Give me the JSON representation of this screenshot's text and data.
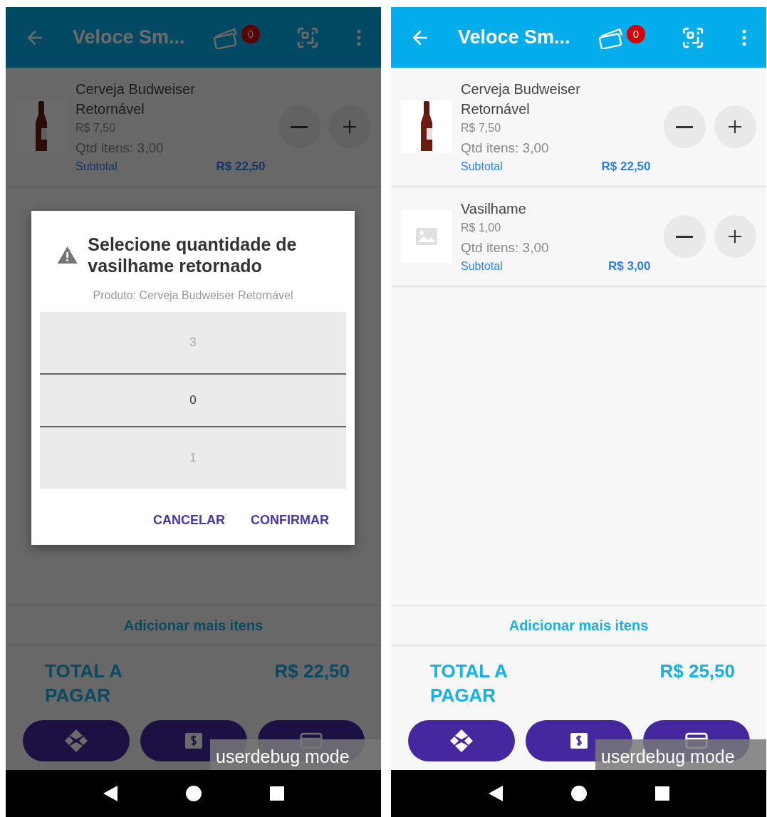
{
  "screens": [
    {
      "app_bar": {
        "title": "Veloce Sm...",
        "cart_count": "0"
      },
      "items": [
        {
          "kind": "bottle",
          "name": "Cerveja Budweiser Retornável",
          "price": "R$ 7,50",
          "quantity": "Qtd itens:  3,00",
          "subtotal_label": "Subtotal",
          "subtotal_value": "R$ 22,50"
        }
      ],
      "add_more": "Adicionar mais itens",
      "total_label": "TOTAL A PAGAR",
      "total_value": "R$ 22,50",
      "pay_buttons": [
        {
          "kind": "pix"
        },
        {
          "kind": "cash"
        },
        {
          "kind": "card"
        }
      ],
      "debug_overlay": "userdebug mode",
      "dialog": {
        "title": "Selecione quantidade de vasilhame retornado",
        "subtitle": "Produto: Cerveja Budweiser Retornável",
        "picker": [
          {
            "label": "3",
            "selected": false
          },
          {
            "label": "0",
            "selected": true
          },
          {
            "label": "1",
            "selected": false
          }
        ],
        "buttons": [
          "CANCELAR",
          "CONFIRMAR"
        ]
      }
    },
    {
      "app_bar": {
        "title": "Veloce Sm...",
        "cart_count": "0"
      },
      "items": [
        {
          "kind": "bottle",
          "name": "Cerveja Budweiser Retornável",
          "price": "R$ 7,50",
          "quantity": "Qtd itens:  3,00",
          "subtotal_label": "Subtotal",
          "subtotal_value": "R$ 22,50"
        },
        {
          "kind": "placeholder",
          "name": "Vasilhame",
          "price": "R$ 1,00",
          "quantity": "Qtd itens:  3,00",
          "subtotal_label": "Subtotal",
          "subtotal_value": "R$ 3,00"
        }
      ],
      "add_more": "Adicionar mais itens",
      "total_label": "TOTAL A PAGAR",
      "total_value": "R$ 25,50",
      "pay_buttons": [
        {
          "kind": "pix"
        },
        {
          "kind": "cash"
        },
        {
          "kind": "card"
        }
      ],
      "debug_overlay": "userdebug mode"
    }
  ]
}
